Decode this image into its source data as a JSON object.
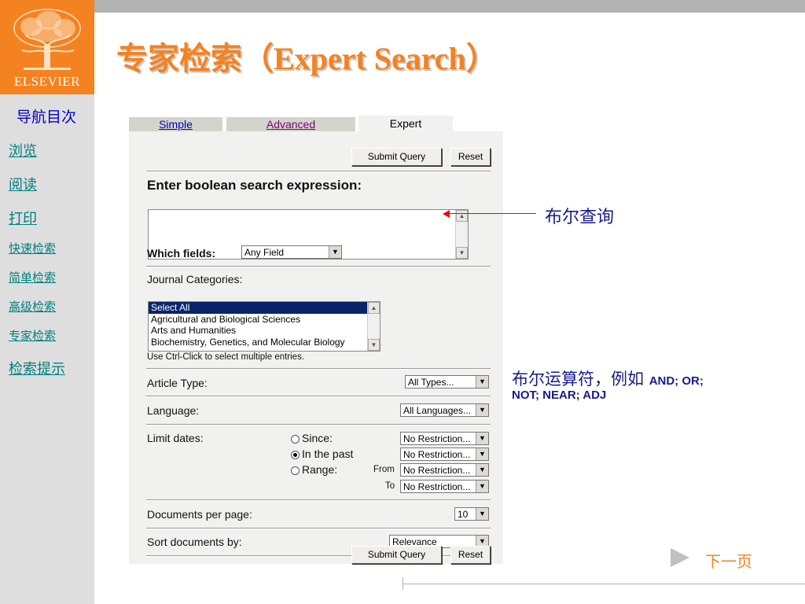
{
  "slide": {
    "title": "专家检索（Expert Search）",
    "logo_text": "ELSEVIER",
    "next_label": "下一页"
  },
  "nav": {
    "title": "导航目次",
    "items": [
      {
        "label": "浏览"
      },
      {
        "label": "阅读"
      },
      {
        "label": "打印"
      },
      {
        "label": "快速检索"
      },
      {
        "label": "简单检索"
      },
      {
        "label": "高级检索"
      },
      {
        "label": "专家检索"
      },
      {
        "label": "检索提示"
      }
    ]
  },
  "tabs": {
    "simple": "Simple",
    "advanced": "Advanced",
    "expert": "Expert"
  },
  "buttons": {
    "submit": "Submit Query",
    "reset": "Reset"
  },
  "form": {
    "expression_label": "Enter boolean search expression:",
    "expression_value": "",
    "which_fields_label": "Which fields:",
    "which_fields_value": "Any Field",
    "journal_label": "Journal Categories:",
    "journal_options": [
      {
        "label": "Select All",
        "selected": true
      },
      {
        "label": "Agricultural and Biological Sciences",
        "selected": false
      },
      {
        "label": "Arts and Humanities",
        "selected": false
      },
      {
        "label": "Biochemistry, Genetics, and Molecular Biology",
        "selected": false
      }
    ],
    "ctrl_hint": "Use Ctrl-Click to select multiple entries.",
    "article_type_label": "Article Type:",
    "article_type_value": "All Types...",
    "language_label": "Language:",
    "language_value": "All Languages...",
    "limit_dates_label": "Limit dates:",
    "since_label": "Since:",
    "in_past_label": "In the past",
    "range_label": "Range:",
    "from_label": "From",
    "to_label": "To",
    "no_restriction": "No Restriction...",
    "selected_date_option": "in_past",
    "docs_per_page_label": "Documents per page:",
    "docs_per_page_value": "10",
    "sort_label": "Sort documents by:",
    "sort_value": "Relevance"
  },
  "annotations": {
    "boolean_query": "布尔查询",
    "operators_line1_cn": "布尔运算符，例如 ",
    "operators_line1_en": "AND; OR;",
    "operators_line2": "NOT; NEAR; ADJ"
  },
  "colors": {
    "accent_orange": "#f58220",
    "nav_link": "#008080",
    "nav_title": "#0000cc",
    "annotation_text": "#1a1a8c",
    "arrow_red": "#ff0000"
  }
}
